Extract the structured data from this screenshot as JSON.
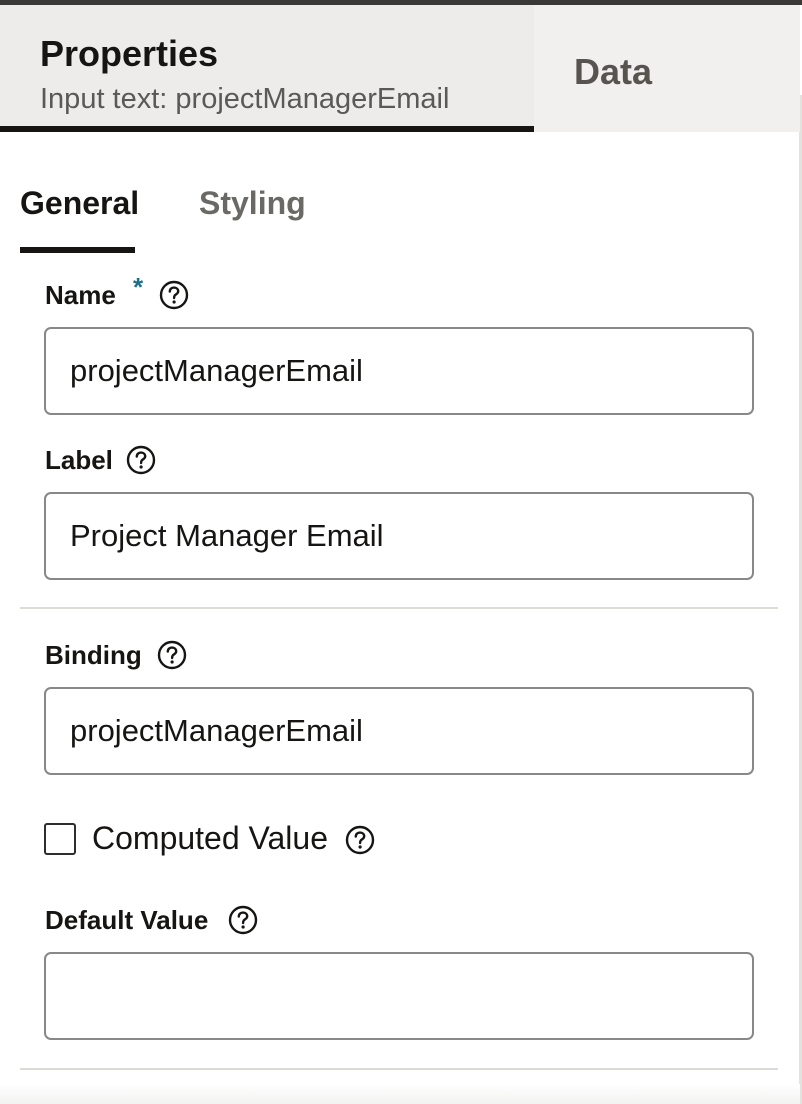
{
  "header": {
    "tabs": {
      "properties": {
        "title": "Properties",
        "subtitle": "Input text: projectManagerEmail"
      },
      "data": {
        "label": "Data"
      }
    }
  },
  "subtabs": {
    "general": "General",
    "styling": "Styling"
  },
  "fields": {
    "name": {
      "label": "Name",
      "required_marker": "*",
      "value": "projectManagerEmail"
    },
    "label": {
      "label": "Label",
      "value": "Project Manager Email"
    },
    "binding": {
      "label": "Binding",
      "value": "projectManagerEmail"
    },
    "computed_value": {
      "label": "Computed Value",
      "checked": false
    },
    "default_value": {
      "label": "Default Value",
      "value": ""
    }
  },
  "icons": {
    "help": "help-circle-icon"
  },
  "colors": {
    "required_star": "#1f6f8b",
    "active_tab_underline": "#161513"
  }
}
